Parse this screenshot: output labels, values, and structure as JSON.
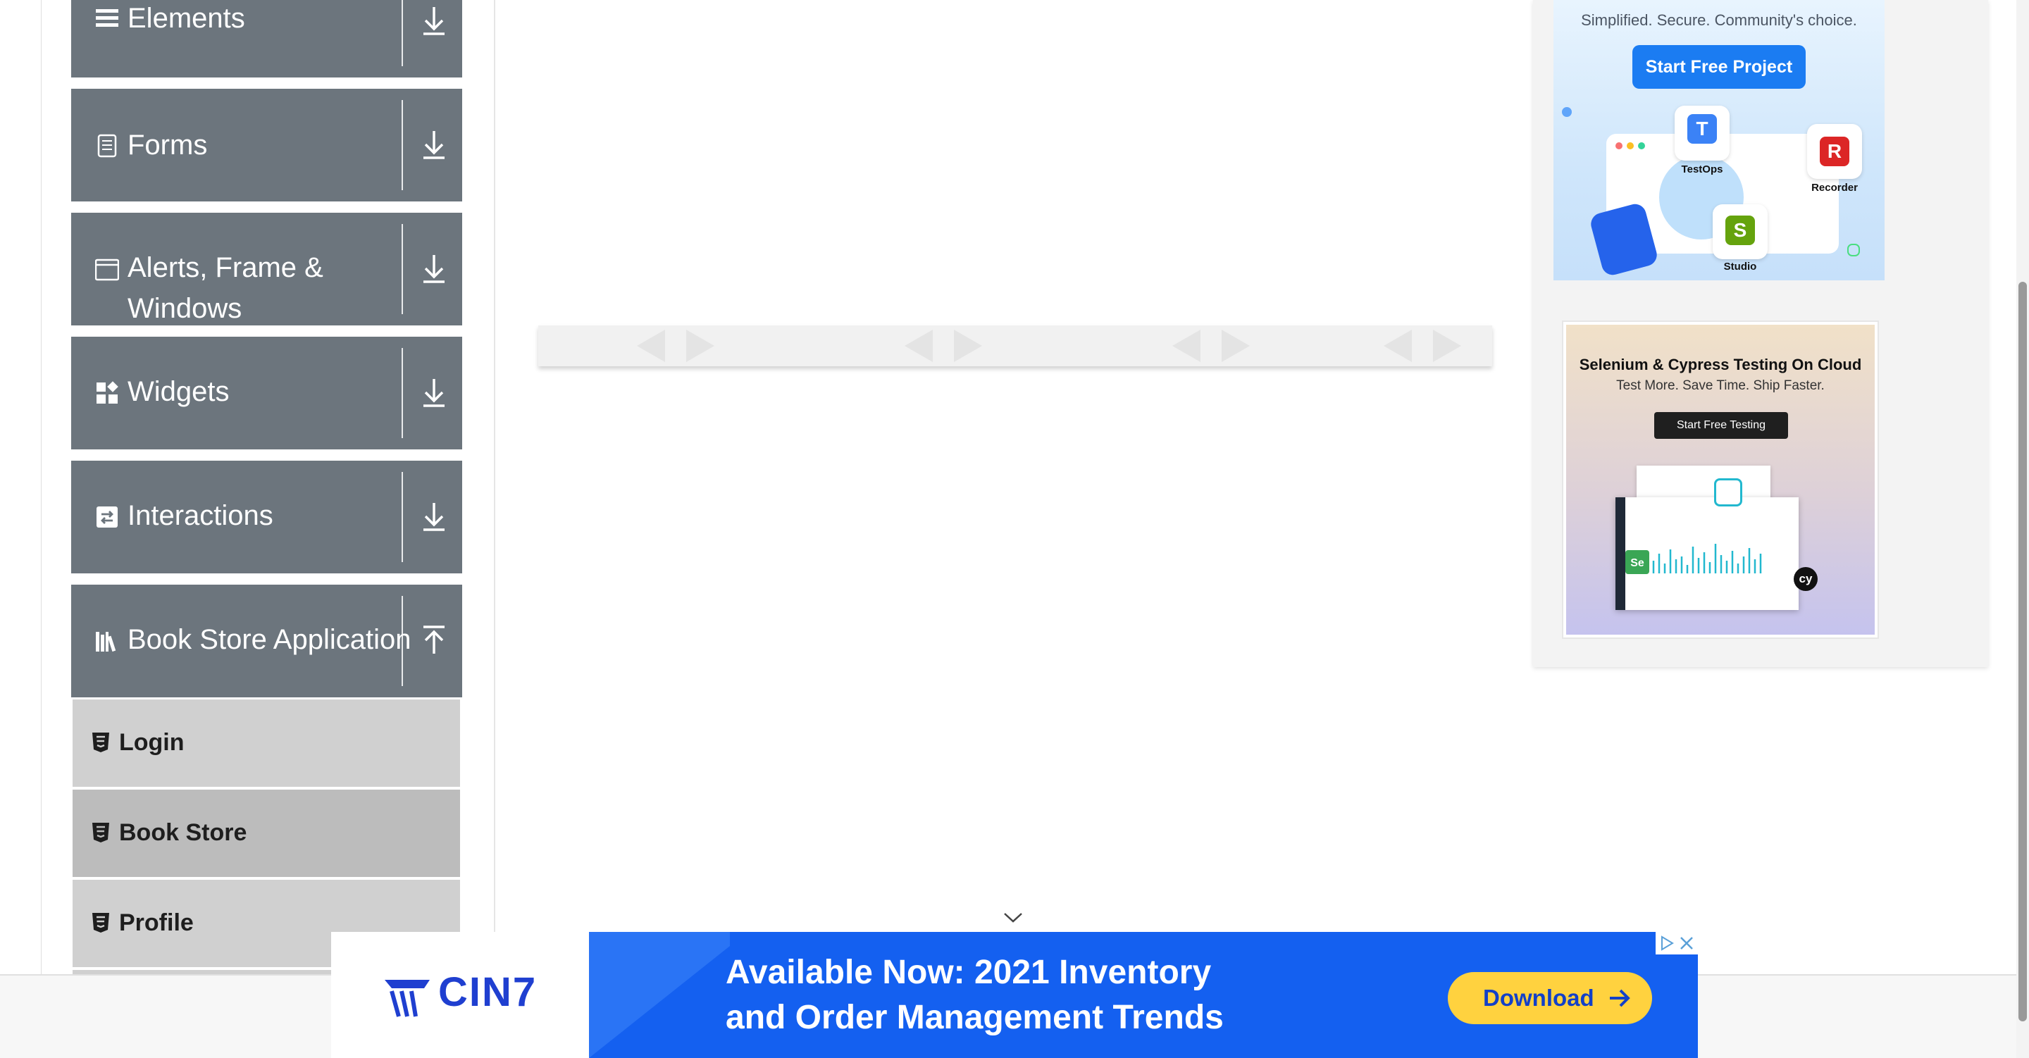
{
  "sidebar": {
    "groups": [
      {
        "label": "Elements",
        "icon": "hamburger-icon",
        "toggle": "download-icon"
      },
      {
        "label": "Forms",
        "icon": "document-icon",
        "toggle": "download-icon"
      },
      {
        "label_line1": "Alerts, Frame &",
        "label_line2": "Windows",
        "icon": "window-icon",
        "toggle": "download-icon"
      },
      {
        "label": "Widgets",
        "icon": "widgets-icon",
        "toggle": "download-icon"
      },
      {
        "label": "Interactions",
        "icon": "interactions-icon",
        "toggle": "download-icon"
      },
      {
        "label": "Book Store Application",
        "icon": "books-icon",
        "toggle": "upload-icon",
        "expanded": true
      }
    ],
    "book_store_items": [
      {
        "label": "Login",
        "icon": "html5-icon"
      },
      {
        "label": "Book Store",
        "icon": "html5-icon"
      },
      {
        "label": "Profile",
        "icon": "html5-icon"
      }
    ]
  },
  "ads": {
    "katalon": {
      "tagline": "Simplified. Secure. Community's choice.",
      "cta": "Start Free Project",
      "apps": [
        "TestOps",
        "Recorder",
        "Studio"
      ]
    },
    "lambdatest": {
      "headline": "Selenium & Cypress Testing On Cloud",
      "subline": "Test More. Save Time. Ship Faster.",
      "cta": "Start Free Testing"
    },
    "banner": {
      "brand": "CIN7",
      "headline_line1": "Available Now: 2021 Inventory",
      "headline_line2": "and Order Management Trends",
      "cta": "Download"
    }
  },
  "colors": {
    "sidebar_group": "#6c757d",
    "sidebar_sub_light": "#d0d0d0",
    "sidebar_sub_active": "#bcbcbc",
    "banner_blue": "#1460f0",
    "banner_button": "#ffd23f",
    "ad_cta_blue": "#1b7cf2"
  }
}
